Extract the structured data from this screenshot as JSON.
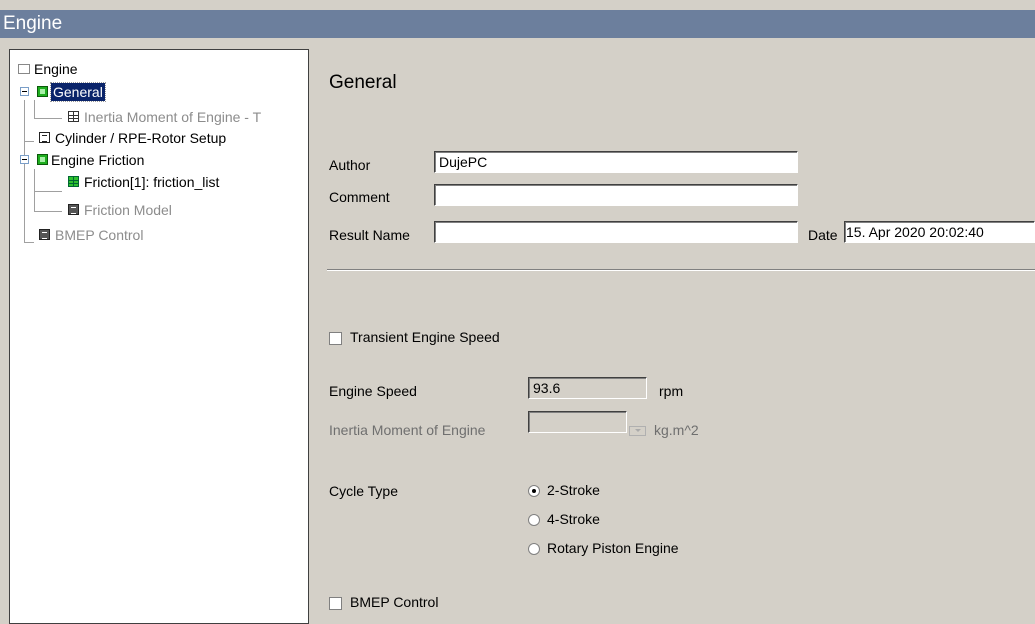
{
  "window": {
    "title": "Engine"
  },
  "tree": {
    "root": "Engine",
    "general": "General",
    "inertia": "Inertia Moment of Engine - T",
    "cylinder": "Cylinder / RPE-Rotor Setup",
    "friction": "Engine Friction",
    "friction_list": "Friction[1]: friction_list",
    "friction_model": "Friction Model",
    "bmep": "BMEP Control"
  },
  "general": {
    "title": "General",
    "author_label": "Author",
    "author_value": "DujePC",
    "comment_label": "Comment",
    "comment_value": "",
    "result_label": "Result Name",
    "result_value": "",
    "date_label": "Date",
    "date_value": "15. Apr 2020 20:02:40"
  },
  "settings": {
    "transient_label": "Transient Engine Speed",
    "transient_checked": false,
    "speed_label": "Engine Speed",
    "speed_value": "93.6",
    "speed_unit": "rpm",
    "inertia_label": "Inertia Moment of Engine",
    "inertia_value": "",
    "inertia_unit": "kg.m^2",
    "cycle_label": "Cycle Type",
    "cycle_options": [
      "2-Stroke",
      "4-Stroke",
      "Rotary Piston Engine"
    ],
    "cycle_selected": "2-Stroke",
    "bmep_label": "BMEP Control",
    "bmep_checked": false
  },
  "colors": {
    "titlebar": "#6c7f9d",
    "selection": "#0a246a",
    "panel": "#d4d0c8"
  }
}
